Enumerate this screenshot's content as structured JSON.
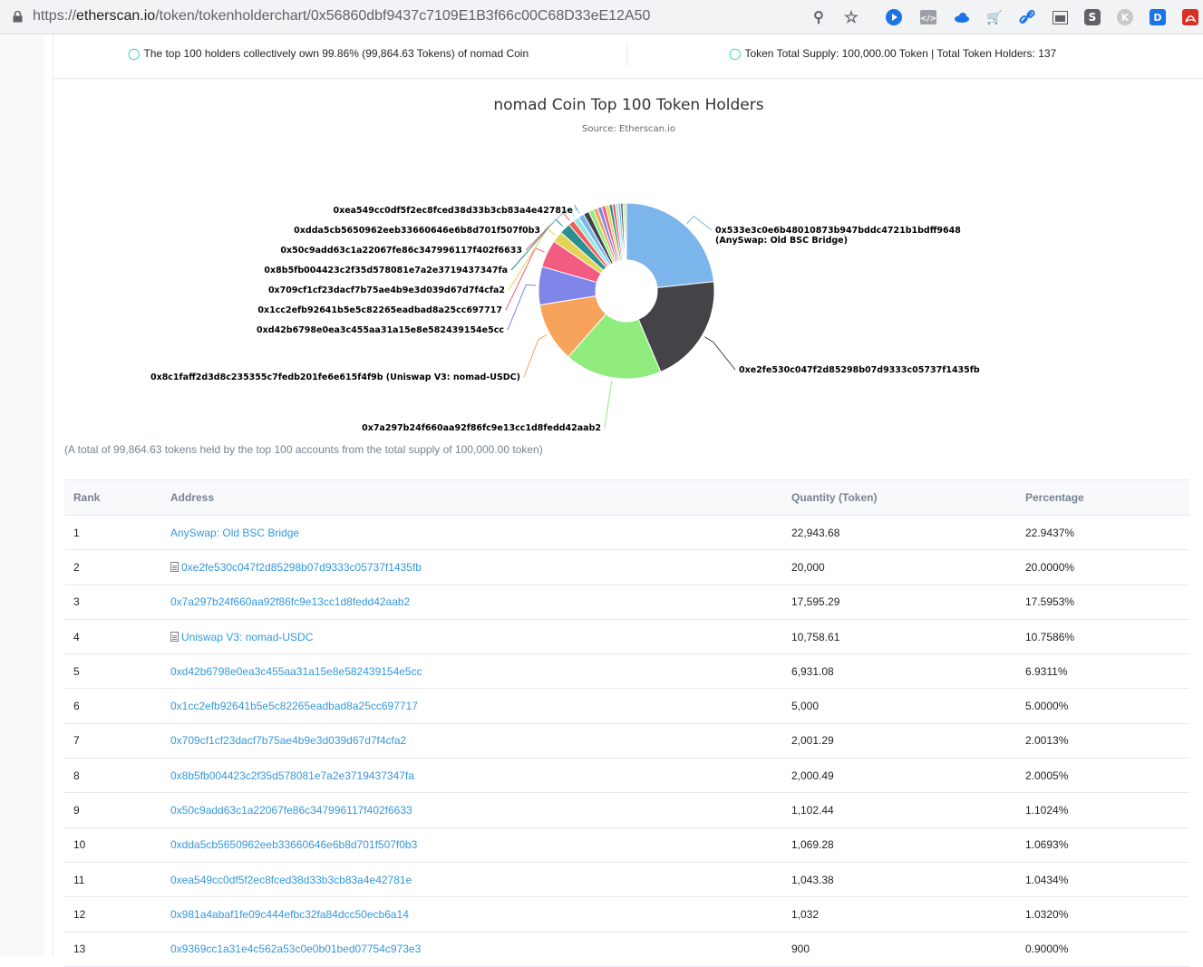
{
  "browser": {
    "url_prefix": "https://",
    "url_host": "etherscan.io",
    "url_path": "/token/tokenholderchart/0x56860dbf9437c7109E1B3f66c00C68D33eE12A50"
  },
  "summary": {
    "left_text": "The top 100 holders collectively own 99.86% (99,864.63 Tokens) of nomad Coin",
    "right_text": "Token Total Supply: 100,000.00 Token  |  Total Token Holders: 137"
  },
  "chart_data": {
    "type": "pie",
    "title": "nomad Coin Top 100 Token Holders",
    "subtitle": "Source: Etherscan.io",
    "inner_hole": true,
    "slices": [
      {
        "label": "0x533e3c0e6b48010873b947bddc4721b1bdff9648",
        "label2": "(AnySwap: Old BSC Bridge)",
        "value": 22.9437,
        "color": "#7cb5ec"
      },
      {
        "label": "0xe2fe530c047f2d85298b07d9333c05737f1435fb",
        "value": 20.0,
        "color": "#434348"
      },
      {
        "label": "0x7a297b24f660aa92f86fc9e13cc1d8fedd42aab2",
        "value": 17.5953,
        "color": "#90ed7d"
      },
      {
        "label": "0x8c1faff2d3d8c235355c7fedb201fe6e615f4f9b (Uniswap V3: nomad-USDC)",
        "value": 10.7586,
        "color": "#f7a35c"
      },
      {
        "label": "0xd42b6798e0ea3c455aa31a15e8e582439154e5cc",
        "value": 6.9311,
        "color": "#8085e9"
      },
      {
        "label": "0x1cc2efb92641b5e5c82265eadbad8a25cc697717",
        "value": 5.0,
        "color": "#f15c80"
      },
      {
        "label": "0x709cf1cf23dacf7b75ae4b9e3d039d67d7f4cfa2",
        "value": 2.0013,
        "color": "#e4d354"
      },
      {
        "label": "0x8b5fb004423c2f35d578081e7a2e3719437347fa",
        "value": 2.0005,
        "color": "#2b908f"
      },
      {
        "label": "0x50c9add63c1a22067fe86c347996117f402f6633",
        "value": 1.1024,
        "color": "#f45b5b"
      },
      {
        "label": "0xdda5cb5650962eeb33660646e6b8d701f507f0b3",
        "value": 1.0693,
        "color": "#91e8e1"
      },
      {
        "label": "0xea549cc0df5f2ec8fced38d33b3cb83a4e42781e",
        "value": 1.0434,
        "color": "#7cb5ec"
      },
      {
        "label": "",
        "value": 1.032,
        "color": "#434348"
      },
      {
        "label": "",
        "value": 0.9,
        "color": "#90ed7d"
      },
      {
        "label": "",
        "value": 0.8,
        "color": "#f7a35c"
      },
      {
        "label": "",
        "value": 0.75,
        "color": "#8085e9"
      },
      {
        "label": "",
        "value": 0.7,
        "color": "#f15c80"
      },
      {
        "label": "",
        "value": 0.65,
        "color": "#e4d354"
      },
      {
        "label": "",
        "value": 0.6,
        "color": "#2b908f"
      },
      {
        "label": "",
        "value": 0.55,
        "color": "#f45b5b"
      },
      {
        "label": "",
        "value": 0.5,
        "color": "#91e8e1"
      },
      {
        "label": "",
        "value": 0.45,
        "color": "#7cb5ec"
      },
      {
        "label": "",
        "value": 0.4,
        "color": "#434348"
      },
      {
        "label": "",
        "value": 0.35,
        "color": "#90ed7d"
      },
      {
        "label": "",
        "value": 0.3,
        "color": "#f7a35c"
      }
    ]
  },
  "note": "(A total of 99,864.63 tokens held by the top 100 accounts from the total supply of 100,000.00 token)",
  "table": {
    "headers": [
      "Rank",
      "Address",
      "Quantity (Token)",
      "Percentage"
    ],
    "rows": [
      {
        "rank": "1",
        "address": "AnySwap: Old BSC Bridge",
        "contract": false,
        "quantity": "22,943.68",
        "percentage": "22.9437%"
      },
      {
        "rank": "2",
        "address": "0xe2fe530c047f2d85298b07d9333c05737f1435fb",
        "contract": true,
        "quantity": "20,000",
        "percentage": "20.0000%"
      },
      {
        "rank": "3",
        "address": "0x7a297b24f660aa92f86fc9e13cc1d8fedd42aab2",
        "contract": false,
        "quantity": "17,595.29",
        "percentage": "17.5953%"
      },
      {
        "rank": "4",
        "address": "Uniswap V3: nomad-USDC",
        "contract": true,
        "quantity": "10,758.61",
        "percentage": "10.7586%"
      },
      {
        "rank": "5",
        "address": "0xd42b6798e0ea3c455aa31a15e8e582439154e5cc",
        "contract": false,
        "quantity": "6,931.08",
        "percentage": "6.9311%"
      },
      {
        "rank": "6",
        "address": "0x1cc2efb92641b5e5c82265eadbad8a25cc697717",
        "contract": false,
        "quantity": "5,000",
        "percentage": "5.0000%"
      },
      {
        "rank": "7",
        "address": "0x709cf1cf23dacf7b75ae4b9e3d039d67d7f4cfa2",
        "contract": false,
        "quantity": "2,001.29",
        "percentage": "2.0013%"
      },
      {
        "rank": "8",
        "address": "0x8b5fb004423c2f35d578081e7a2e3719437347fa",
        "contract": false,
        "quantity": "2,000.49",
        "percentage": "2.0005%"
      },
      {
        "rank": "9",
        "address": "0x50c9add63c1a22067fe86c347996117f402f6633",
        "contract": false,
        "quantity": "1,102.44",
        "percentage": "1.1024%"
      },
      {
        "rank": "10",
        "address": "0xdda5cb5650962eeb33660646e6b8d701f507f0b3",
        "contract": false,
        "quantity": "1,069.28",
        "percentage": "1.0693%"
      },
      {
        "rank": "11",
        "address": "0xea549cc0df5f2ec8fced38d33b3cb83a4e42781e",
        "contract": false,
        "quantity": "1,043.38",
        "percentage": "1.0434%"
      },
      {
        "rank": "12",
        "address": "0x981a4abaf1fe09c444efbc32fa84dcc50ecb6a14",
        "contract": false,
        "quantity": "1,032",
        "percentage": "1.0320%"
      },
      {
        "rank": "13",
        "address": "0x9369cc1a31e4c562a53c0e0b01bed07754c973e3",
        "contract": false,
        "quantity": "900",
        "percentage": "0.9000%"
      }
    ]
  }
}
